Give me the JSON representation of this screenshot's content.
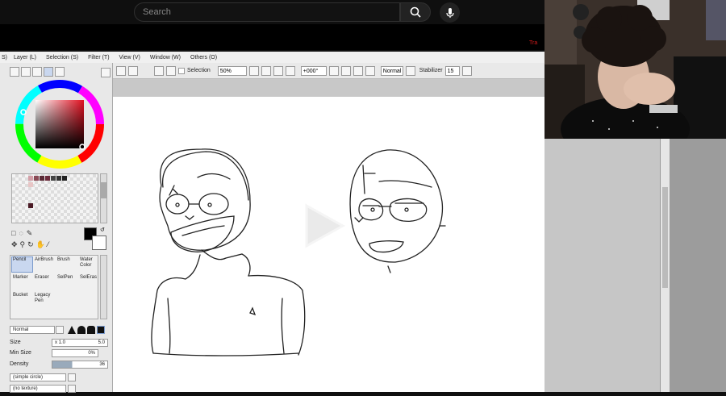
{
  "youtube": {
    "search_placeholder": "Search",
    "edge_text": "Tra"
  },
  "menu": [
    "Layer (L)",
    "Selection (S)",
    "Filter (T)",
    "View (V)",
    "Window (W)",
    "Others (O)"
  ],
  "toolbar": {
    "selection_label": "Selection",
    "zoom": "50%",
    "rotation": "+000°",
    "blend": "Normal",
    "stabilizer_label": "Stabilizer",
    "stabilizer_value": "15"
  },
  "tools": {
    "pencil": "Pencil",
    "airbrush": "AirBrush",
    "brush": "Brush",
    "water": "Water",
    "color": "Color",
    "marker": "Marker",
    "eraser": "Eraser",
    "selpen": "SelPen",
    "selerase": "SelEras",
    "bucket": "Bucket",
    "legacy": "Legacy",
    "pen": "Pen"
  },
  "brush_settings": {
    "mode": "Normal",
    "size_label": "Size",
    "size_multiplier": "x 1.0",
    "size_value": "5.0",
    "min_size_label": "Min Size",
    "min_size_value": "0%",
    "density_label": "Density",
    "density_value": "36",
    "shape": "(simple circle)",
    "texture": "(no texture)"
  },
  "colors": {
    "current": "#000000",
    "accent_red": "#d31b1b"
  }
}
